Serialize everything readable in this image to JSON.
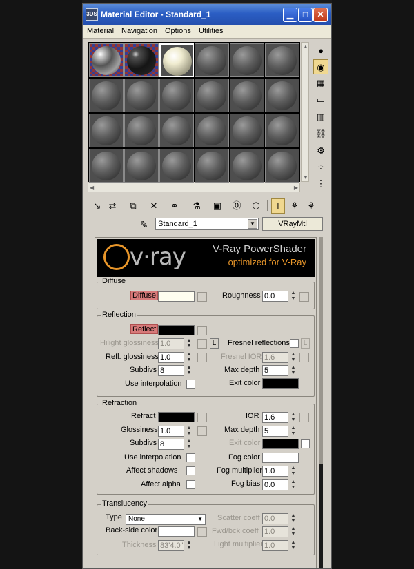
{
  "window": {
    "title": "Material Editor - Standard_1",
    "app_icon": "3DS"
  },
  "menubar": [
    "Material",
    "Navigation",
    "Options",
    "Utilities"
  ],
  "material": {
    "name": "Standard_1",
    "type": "VRayMtl"
  },
  "banner": {
    "logo": "v·ray",
    "title": "V-Ray PowerShader",
    "subtitle": "optimized for V-Ray"
  },
  "diffuse": {
    "group": "Diffuse",
    "diffuse_label": "Diffuse",
    "diffuse_color": "#fffef0",
    "roughness_label": "Roughness",
    "roughness": "0.0"
  },
  "reflection": {
    "group": "Reflection",
    "reflect_label": "Reflect",
    "reflect_color": "#000000",
    "hilight_label": "Hilight glossiness",
    "hilight": "1.0",
    "l_label": "L",
    "fresnel_label": "Fresnel reflections",
    "refl_gloss_label": "Refl. glossiness",
    "refl_gloss": "1.0",
    "fresnel_ior_label": "Fresnel IOR",
    "fresnel_ior": "1.6",
    "subdivs_label": "Subdivs",
    "subdivs": "8",
    "max_depth_label": "Max depth",
    "max_depth": "5",
    "use_interp_label": "Use interpolation",
    "exit_label": "Exit color",
    "exit_color": "#000000"
  },
  "refraction": {
    "group": "Refraction",
    "refract_label": "Refract",
    "refract_color": "#000000",
    "ior_label": "IOR",
    "ior": "1.6",
    "gloss_label": "Glossiness",
    "gloss": "1.0",
    "max_depth_label": "Max depth",
    "max_depth": "5",
    "subdivs_label": "Subdivs",
    "subdivs": "8",
    "exit_label": "Exit color",
    "exit_color": "#000000",
    "use_interp_label": "Use interpolation",
    "fog_color_label": "Fog color",
    "fog_color": "#ffffff",
    "affect_shadows_label": "Affect shadows",
    "fog_mult_label": "Fog multiplier",
    "fog_mult": "1.0",
    "affect_alpha_label": "Affect alpha",
    "fog_bias_label": "Fog bias",
    "fog_bias": "0.0"
  },
  "translucency": {
    "group": "Translucency",
    "type_label": "Type",
    "type": "None",
    "scatter_label": "Scatter coeff",
    "scatter": "0.0",
    "backside_label": "Back-side color",
    "backside_color": "#ffffff",
    "fwd_label": "Fwd/bck coeff",
    "fwd": "1.0",
    "thickness_label": "Thickness",
    "thickness": "83'4.0\"",
    "light_mult_label": "Light multiplier",
    "light_mult": "1.0"
  }
}
